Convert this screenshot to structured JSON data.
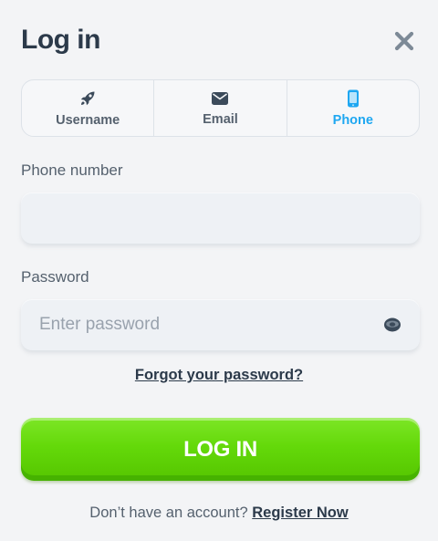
{
  "modal": {
    "title": "Log in"
  },
  "tabs": [
    {
      "label": "Username",
      "icon": "rocket-icon",
      "active": false
    },
    {
      "label": "Email",
      "icon": "envelope-icon",
      "active": false
    },
    {
      "label": "Phone",
      "icon": "phone-icon",
      "active": true
    }
  ],
  "phone": {
    "label": "Phone number",
    "value": "",
    "placeholder": ""
  },
  "password": {
    "label": "Password",
    "value": "",
    "placeholder": "Enter password"
  },
  "forgot_link": "Forgot your password?",
  "login_button": "LOG IN",
  "footer": {
    "prompt": "Don’t have an account?",
    "register_link": "Register Now"
  },
  "colors": {
    "background": "#f3f4f6",
    "text_dark": "#2c3a4a",
    "text_muted": "#55616e",
    "active_tab": "#1ea7f1",
    "button_green": "#64d90a",
    "input_bg": "#eef1f5"
  }
}
